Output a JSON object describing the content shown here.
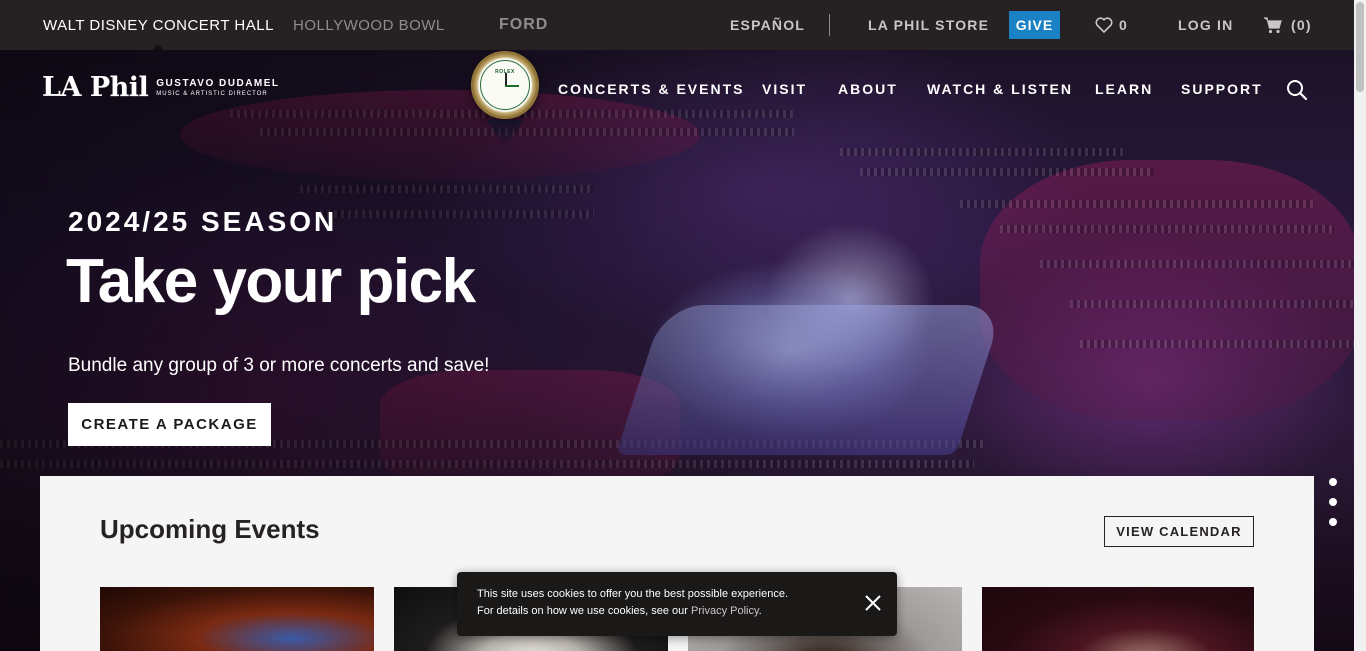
{
  "topbar": {
    "venues": [
      {
        "label": "WALT DISNEY CONCERT HALL",
        "active": true
      },
      {
        "label": "HOLLYWOOD BOWL",
        "active": false
      },
      {
        "label": "FORD",
        "active": false
      }
    ],
    "language": "ESPAÑOL",
    "store": "LA PHIL STORE",
    "give": "GIVE",
    "favorites_count": "0",
    "login": "LOG IN",
    "cart_count": "(0)"
  },
  "header": {
    "logo": {
      "name": "LA Phil",
      "director": "GUSTAVO DUDAMEL",
      "director_title": "MUSIC & ARTISTIC DIRECTOR"
    },
    "clock_brand": "ROLEX",
    "nav": [
      "CONCERTS & EVENTS",
      "VISIT",
      "ABOUT",
      "WATCH & LISTEN",
      "LEARN",
      "SUPPORT"
    ]
  },
  "hero": {
    "season": "2024/25 SEASON",
    "headline": "Take your pick",
    "subtitle": "Bundle any group of 3 or more concerts and save!",
    "cta": "CREATE A PACKAGE",
    "slides_total": 3
  },
  "events": {
    "title": "Upcoming Events",
    "view_calendar": "VIEW CALENDAR"
  },
  "cookie": {
    "line1": "This site uses cookies to offer you the best possible experience.",
    "line2_prefix": "For details on how we use cookies, see our ",
    "link": "Privacy Policy",
    "line2_suffix": "."
  },
  "colors": {
    "topbar_bg": "#262223",
    "give_blue": "#1a82c4",
    "panel_bg": "#f5f5f5",
    "text_dark": "#262223"
  },
  "icons": [
    "heart-icon",
    "cart-icon",
    "search-icon",
    "close-icon"
  ]
}
